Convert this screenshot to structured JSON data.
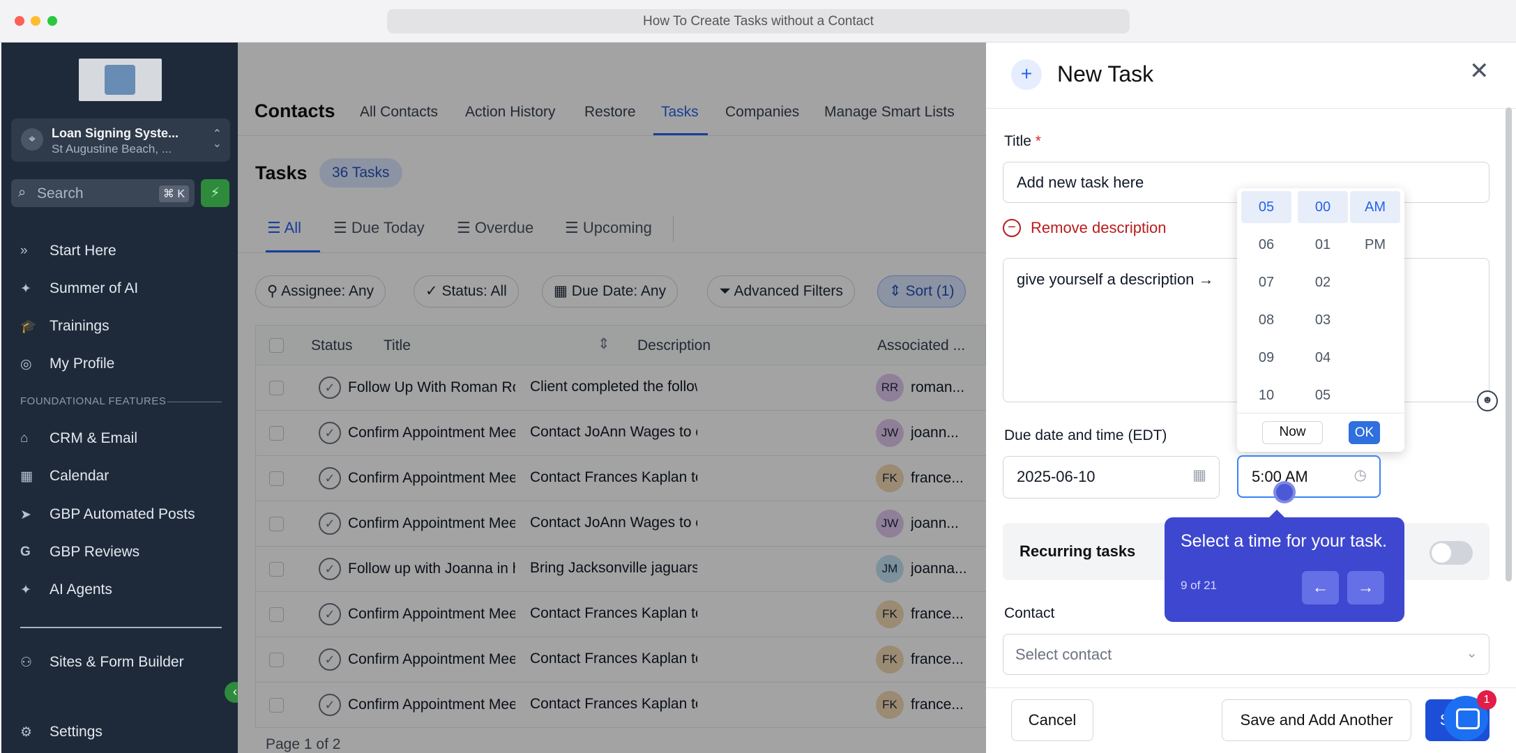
{
  "browser": {
    "url_title": "How To Create Tasks without a Contact"
  },
  "colors": {
    "accent": "#2563eb",
    "sidebar_bg": "#1e2a3a",
    "tour_bg": "#3e47cf",
    "danger": "#b91c1c",
    "green": "#2e8b3c"
  },
  "sidebar": {
    "location_name": "Loan Signing Syste...",
    "location_sub": "St Augustine Beach, ...",
    "search_placeholder": "Search",
    "search_shortcut": "⌘ K",
    "items_top": [
      {
        "label": "Start Here",
        "icon": "double-chevron-icon"
      },
      {
        "label": "Summer of AI",
        "icon": "sparkle-icon"
      },
      {
        "label": "Trainings",
        "icon": "graduation-cap-icon"
      },
      {
        "label": "My Profile",
        "icon": "user-circle-icon"
      }
    ],
    "section_label": "FOUNDATIONAL FEATURES",
    "items_section": [
      {
        "label": "CRM & Email",
        "icon": "inbox-icon"
      },
      {
        "label": "Calendar",
        "icon": "calendar-icon"
      },
      {
        "label": "GBP Automated Posts",
        "icon": "send-icon"
      },
      {
        "label": "GBP Reviews",
        "icon": "google-icon"
      },
      {
        "label": "AI Agents",
        "icon": "sparkle-icon"
      }
    ],
    "items_bottom": [
      {
        "label": "Sites & Form Builder",
        "icon": "sitemap-icon"
      }
    ],
    "settings_label": "Settings"
  },
  "main": {
    "section_title": "Contacts",
    "tabs": [
      "All Contacts",
      "Action History",
      "Restore",
      "Tasks",
      "Companies",
      "Manage Smart Lists"
    ],
    "active_tab": "Tasks",
    "tasks_title": "Tasks",
    "tasks_count": "36 Tasks",
    "view_tabs": [
      "All",
      "Due Today",
      "Overdue",
      "Upcoming"
    ],
    "filters": {
      "assignee": "Assignee: Any",
      "status": "Status: All",
      "due_date": "Due Date: Any",
      "advanced": "Advanced Filters",
      "sort": "Sort (1)"
    },
    "columns": [
      "Status",
      "Title",
      "Description",
      "Associated ..."
    ],
    "rows": [
      {
        "title": "Follow Up With Roman Rosario",
        "description": "Client completed the follow up...",
        "initials": "RR",
        "contact": "roman...",
        "avatar_bg": "#e2c7ef"
      },
      {
        "title": "Confirm Appointment Meeting...",
        "description": "Contact JoAnn Wages to confi...",
        "initials": "JW",
        "contact": "joann...",
        "avatar_bg": "#e2c7ef"
      },
      {
        "title": "Confirm Appointment Meeting...",
        "description": "Contact Frances Kaplan to co...",
        "initials": "FK",
        "contact": "france...",
        "avatar_bg": "#f3d9b5"
      },
      {
        "title": "Confirm Appointment Meeting...",
        "description": "Contact JoAnn Wages to confi...",
        "initials": "JW",
        "contact": "joann...",
        "avatar_bg": "#e2c7ef"
      },
      {
        "title": "Follow up with Joanna in her o...",
        "description": "Bring Jacksonville jaguars trea...",
        "initials": "JM",
        "contact": "joanna...",
        "avatar_bg": "#c2e3f3"
      },
      {
        "title": "Confirm Appointment Meeting...",
        "description": "Contact Frances Kaplan to co...",
        "initials": "FK",
        "contact": "france...",
        "avatar_bg": "#f3d9b5"
      },
      {
        "title": "Confirm Appointment Meeting...",
        "description": "Contact Frances Kaplan to co...",
        "initials": "FK",
        "contact": "france...",
        "avatar_bg": "#f3d9b5"
      },
      {
        "title": "Confirm Appointment Meeting...",
        "description": "Contact Frances Kaplan to co...",
        "initials": "FK",
        "contact": "france...",
        "avatar_bg": "#f3d9b5"
      }
    ],
    "pager": "Page 1 of 2"
  },
  "panel": {
    "title": "New Task",
    "title_label": "Title",
    "title_placeholder": "Add new task here",
    "remove_description": "Remove description",
    "description_value": "give yourself a description →",
    "due_label": "Due date and time (EDT)",
    "date_value": "2025-06-10",
    "time_value": "5:00 AM",
    "recurring_label": "Recurring tasks",
    "contact_label": "Contact",
    "contact_placeholder": "Select contact",
    "cancel": "Cancel",
    "save_add": "Save and Add Another",
    "save": "Save"
  },
  "picker": {
    "hours": [
      "05",
      "06",
      "07",
      "08",
      "09",
      "10"
    ],
    "minutes": [
      "00",
      "01",
      "02",
      "03",
      "04",
      "05"
    ],
    "periods": [
      "AM",
      "PM"
    ],
    "now": "Now",
    "ok": "OK"
  },
  "tour": {
    "text": "Select a time for your task.",
    "step": "9 of 21"
  },
  "chat_badge": "1"
}
